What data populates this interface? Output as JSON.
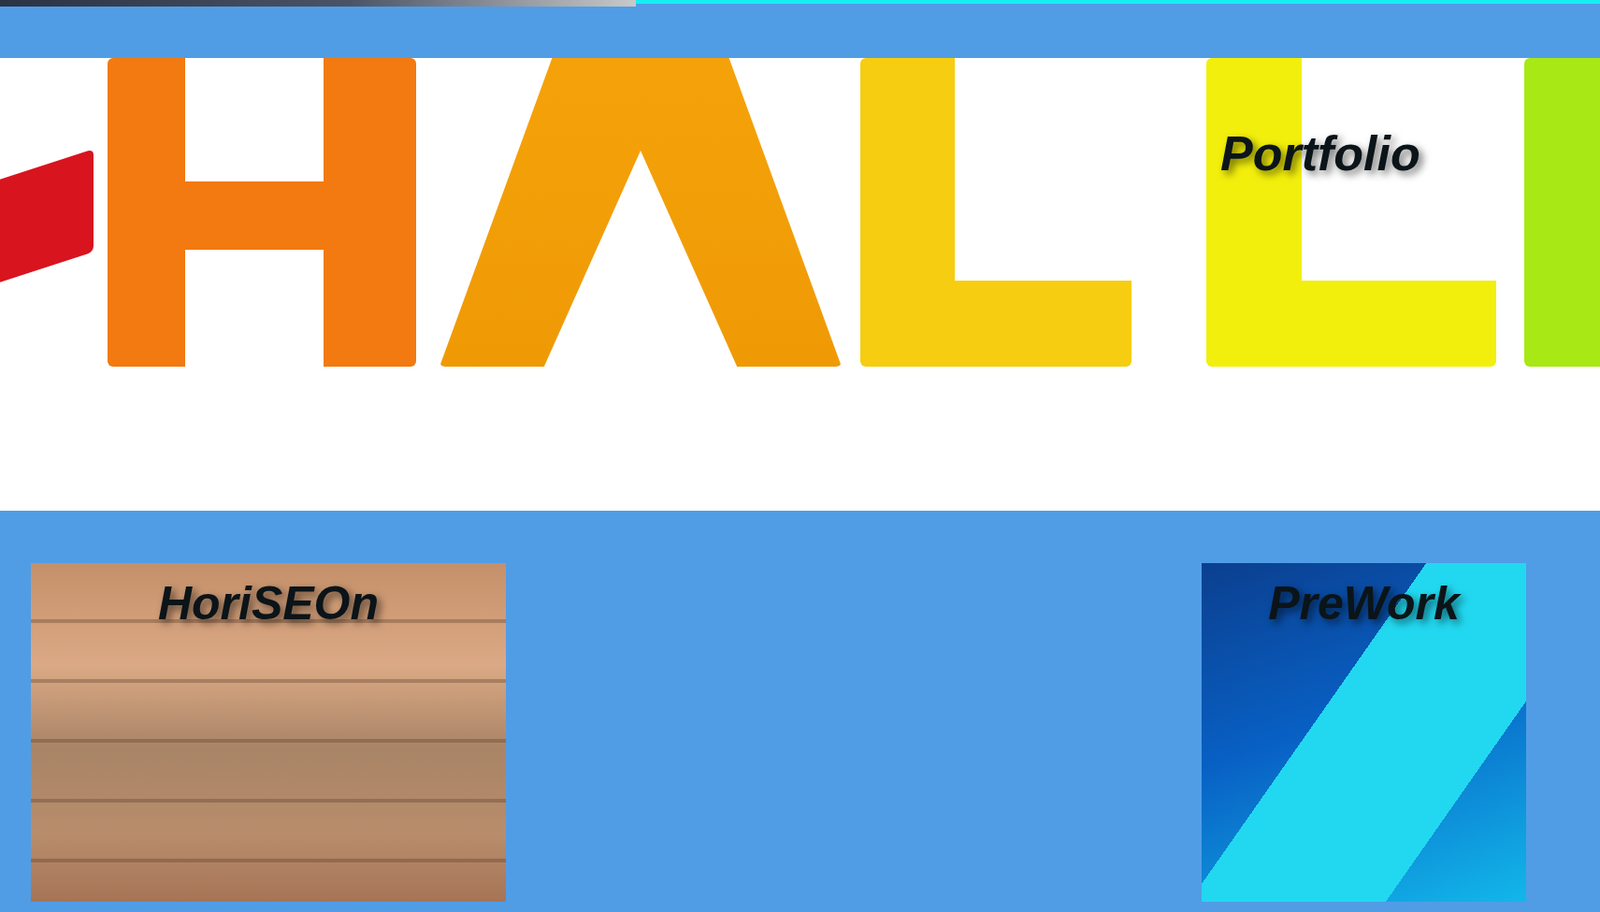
{
  "hero": {
    "title": "Portfolio"
  },
  "projects": [
    {
      "title": "HoriSEOn",
      "kind": "wood"
    },
    {
      "title": "PreWork",
      "kind": "study"
    }
  ]
}
